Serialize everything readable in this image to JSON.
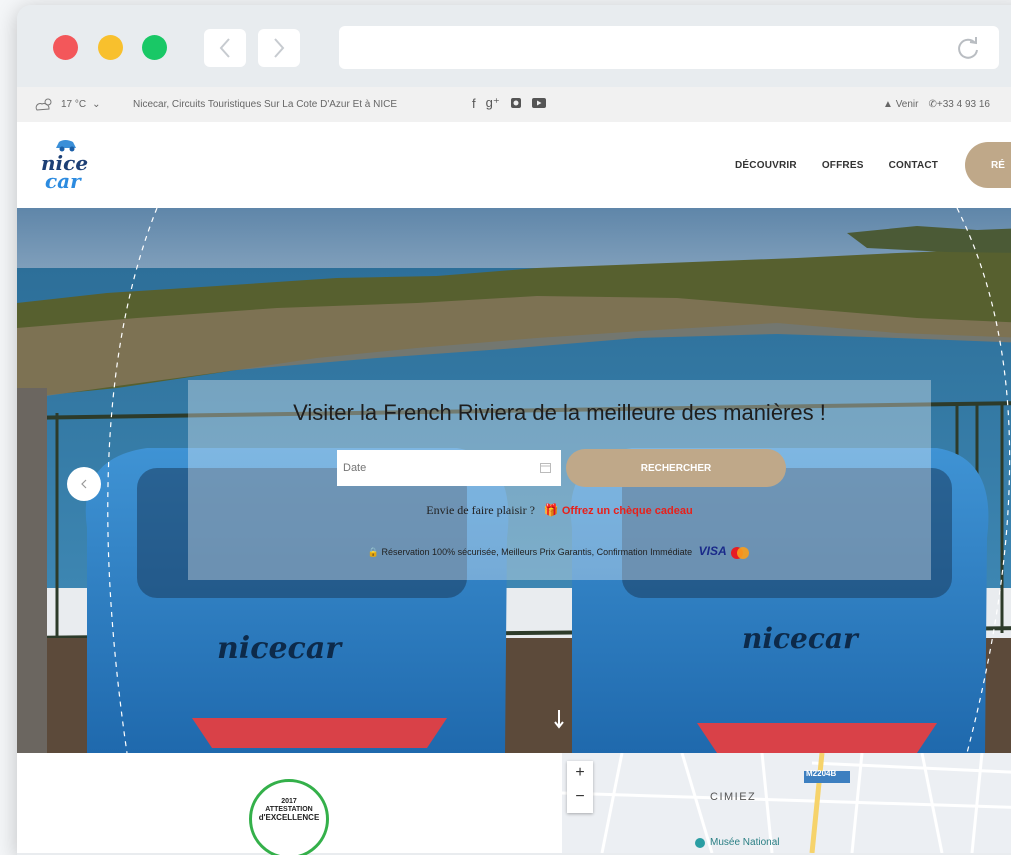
{
  "infobar": {
    "temperature": "17 °C",
    "tagline": "Nicecar, Circuits Touristiques Sur La Cote D'Azur Et à NICE",
    "social_icons": [
      "facebook-icon",
      "google-plus-icon",
      "instagram-icon",
      "youtube-icon"
    ],
    "venir": "Venir",
    "phone": "+33 4 93 16"
  },
  "header": {
    "menu": [
      "DÉCOUVRIR",
      "OFFRES",
      "CONTACT"
    ],
    "reserve_label": "RÉ"
  },
  "hero": {
    "headline": "Visiter la French Riviera de la meilleure des manières !",
    "date_placeholder": "Date",
    "search_label": "RECHERCHER",
    "gift_prompt": "Envie de faire plaisir ?",
    "gift_link": "Offrez un chèque cadeau",
    "secure_text": "Réservation 100% sécurisée, Meilleurs Prix Garantis, Confirmation Immédiate",
    "payment_visa": "VISA"
  },
  "award": {
    "year": "2017",
    "line1": "ATTESTATION",
    "line2": "d'EXCELLENCE"
  },
  "map": {
    "district": "CIMIEZ",
    "poi": "Musée National",
    "road": "M2204B",
    "zoom_in": "+",
    "zoom_out": "−"
  },
  "colors": {
    "accent": "#bfa889",
    "gift_red": "#e8201a",
    "close": "#f3575a",
    "minimize": "#f8c02d",
    "maximize": "#19c866"
  }
}
